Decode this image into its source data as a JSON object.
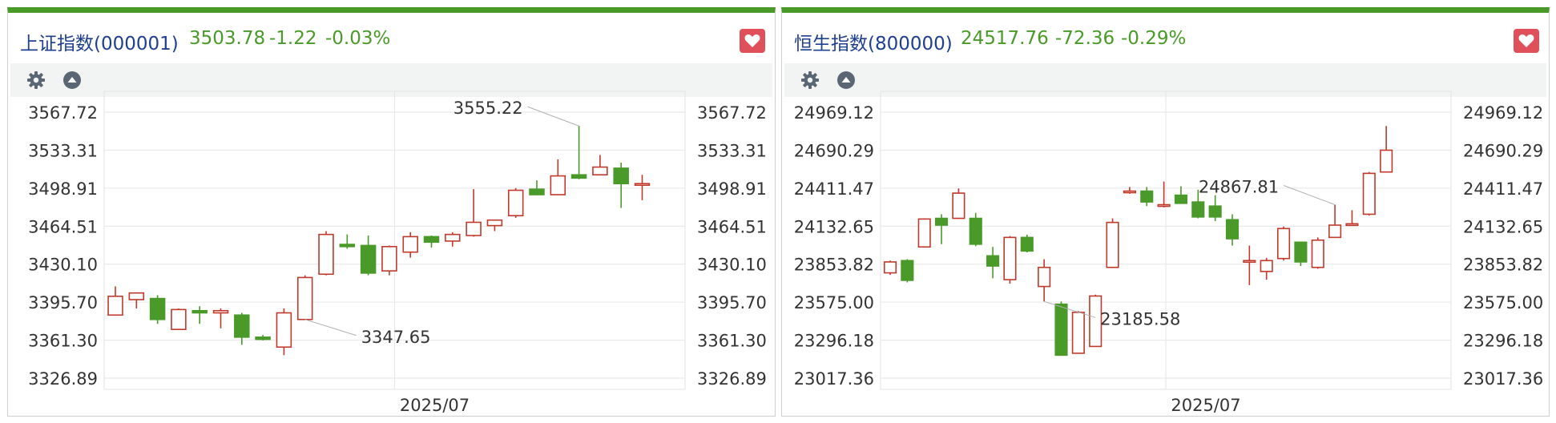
{
  "colors": {
    "up": "#c0392b",
    "down": "#4a9a2a",
    "name": "#1f3f8f",
    "accent": "#4a9a2a",
    "fav": "#e0505a"
  },
  "panels": [
    {
      "name": "上证指数(000001)",
      "price": "3503.78",
      "change": "-1.22",
      "change_pct": "-0.03%",
      "icons": [
        "gear-icon",
        "collapse-up-icon",
        "heart-icon"
      ]
    },
    {
      "name": "恒生指数(800000)",
      "price": "24517.76",
      "change": "-72.36",
      "change_pct": "-0.29%",
      "icons": [
        "gear-icon",
        "collapse-up-icon",
        "heart-icon"
      ]
    }
  ],
  "chart_data": [
    {
      "type": "candlestick",
      "x_label": "2025/07",
      "y_ticks": [
        "3567.72",
        "3533.31",
        "3498.91",
        "3464.51",
        "3430.10",
        "3395.70",
        "3361.30",
        "3326.89"
      ],
      "y_tick_values": [
        3567.72,
        3533.31,
        3498.91,
        3464.51,
        3430.1,
        3395.7,
        3361.3,
        3326.89
      ],
      "ylim": [
        3326.89,
        3567.72
      ],
      "high_label": "3555.22",
      "low_label": "3347.65",
      "high_index": 22,
      "low_index": 9,
      "grid": true,
      "candles": [
        {
          "o": 3384,
          "h": 3410,
          "c": 3401,
          "l": 3384
        },
        {
          "o": 3398,
          "h": 3404,
          "c": 3404,
          "l": 3390
        },
        {
          "o": 3399,
          "h": 3402,
          "c": 3380,
          "l": 3376
        },
        {
          "o": 3371,
          "h": 3390,
          "c": 3389,
          "l": 3371
        },
        {
          "o": 3388,
          "h": 3392,
          "c": 3386,
          "l": 3376
        },
        {
          "o": 3386,
          "h": 3390,
          "c": 3388,
          "l": 3372
        },
        {
          "o": 3384,
          "h": 3386,
          "c": 3364,
          "l": 3357
        },
        {
          "o": 3364,
          "h": 3366,
          "c": 3362,
          "l": 3361
        },
        {
          "o": 3355,
          "h": 3390,
          "c": 3386,
          "l": 3347.65
        },
        {
          "o": 3380,
          "h": 3420,
          "c": 3418,
          "l": 3380
        },
        {
          "o": 3421,
          "h": 3460,
          "c": 3457,
          "l": 3420
        },
        {
          "o": 3448,
          "h": 3457,
          "c": 3446,
          "l": 3444
        },
        {
          "o": 3447,
          "h": 3456,
          "c": 3422,
          "l": 3420
        },
        {
          "o": 3424,
          "h": 3447,
          "c": 3446,
          "l": 3420
        },
        {
          "o": 3441,
          "h": 3459,
          "c": 3455,
          "l": 3436
        },
        {
          "o": 3455,
          "h": 3456,
          "c": 3450,
          "l": 3445
        },
        {
          "o": 3451,
          "h": 3459,
          "c": 3457,
          "l": 3446
        },
        {
          "o": 3456,
          "h": 3498,
          "c": 3468,
          "l": 3455
        },
        {
          "o": 3465,
          "h": 3470,
          "c": 3470,
          "l": 3460
        },
        {
          "o": 3474,
          "h": 3499,
          "c": 3497,
          "l": 3472
        },
        {
          "o": 3498,
          "h": 3506,
          "c": 3493,
          "l": 3493
        },
        {
          "o": 3493,
          "h": 3525,
          "c": 3510,
          "l": 3493
        },
        {
          "o": 3511,
          "h": 3555.22,
          "c": 3508,
          "l": 3507
        },
        {
          "o": 3511,
          "h": 3529,
          "c": 3518,
          "l": 3511
        },
        {
          "o": 3517,
          "h": 3522,
          "c": 3503,
          "l": 3481
        },
        {
          "o": 3503,
          "h": 3511,
          "c": 3503,
          "l": 3488
        }
      ]
    },
    {
      "type": "candlestick",
      "x_label": "2025/07",
      "y_ticks": [
        "24969.12",
        "24690.29",
        "24411.47",
        "24132.65",
        "23853.82",
        "23575.00",
        "23296.18",
        "23017.36"
      ],
      "y_tick_values": [
        24969.12,
        24690.29,
        24411.47,
        24132.65,
        23853.82,
        23575.0,
        23296.18,
        23017.36
      ],
      "ylim": [
        23017.36,
        24969.12
      ],
      "high_label": "24867.81",
      "low_label": "23185.58",
      "high_index": 26,
      "low_index": 9,
      "grid": true,
      "candles": [
        {
          "o": 23790,
          "h": 23880,
          "c": 23870,
          "l": 23775
        },
        {
          "o": 23880,
          "h": 23890,
          "c": 23735,
          "l": 23720
        },
        {
          "o": 23980,
          "h": 24190,
          "c": 24185,
          "l": 23975
        },
        {
          "o": 24190,
          "h": 24220,
          "c": 24140,
          "l": 24000
        },
        {
          "o": 24190,
          "h": 24410,
          "c": 24375,
          "l": 24185
        },
        {
          "o": 24190,
          "h": 24230,
          "c": 24000,
          "l": 23985
        },
        {
          "o": 23915,
          "h": 23980,
          "c": 23840,
          "l": 23750
        },
        {
          "o": 23740,
          "h": 24060,
          "c": 24050,
          "l": 23710
        },
        {
          "o": 24050,
          "h": 24070,
          "c": 23950,
          "l": 23940
        },
        {
          "o": 23690,
          "h": 23890,
          "c": 23830,
          "l": 23580
        },
        {
          "o": 23560,
          "h": 23580,
          "c": 23185.58,
          "l": 23185.58
        },
        {
          "o": 23200,
          "h": 23510,
          "c": 23500,
          "l": 23200
        },
        {
          "o": 23250,
          "h": 23630,
          "c": 23620,
          "l": 23250
        },
        {
          "o": 23830,
          "h": 24190,
          "c": 24160,
          "l": 23830
        },
        {
          "o": 24380,
          "h": 24420,
          "c": 24390,
          "l": 24370
        },
        {
          "o": 24390,
          "h": 24420,
          "c": 24310,
          "l": 24280
        },
        {
          "o": 24290,
          "h": 24460,
          "c": 24290,
          "l": 24270
        },
        {
          "o": 24360,
          "h": 24425,
          "c": 24300,
          "l": 24300
        },
        {
          "o": 24310,
          "h": 24400,
          "c": 24200,
          "l": 24190
        },
        {
          "o": 24280,
          "h": 24360,
          "c": 24200,
          "l": 24170
        },
        {
          "o": 24180,
          "h": 24220,
          "c": 24040,
          "l": 23990
        },
        {
          "o": 23880,
          "h": 23990,
          "c": 23880,
          "l": 23700
        },
        {
          "o": 23800,
          "h": 23900,
          "c": 23880,
          "l": 23740
        },
        {
          "o": 23895,
          "h": 24130,
          "c": 24115,
          "l": 23880
        },
        {
          "o": 24015,
          "h": 24020,
          "c": 23870,
          "l": 23840
        },
        {
          "o": 23830,
          "h": 24050,
          "c": 24030,
          "l": 23820
        },
        {
          "o": 24050,
          "h": 24290,
          "c": 24140,
          "l": 24050
        },
        {
          "o": 24140,
          "h": 24250,
          "c": 24150,
          "l": 24140
        },
        {
          "o": 24220,
          "h": 24530,
          "c": 24520,
          "l": 24210
        },
        {
          "o": 24530,
          "h": 24867.81,
          "c": 24690,
          "l": 24530
        }
      ]
    }
  ]
}
